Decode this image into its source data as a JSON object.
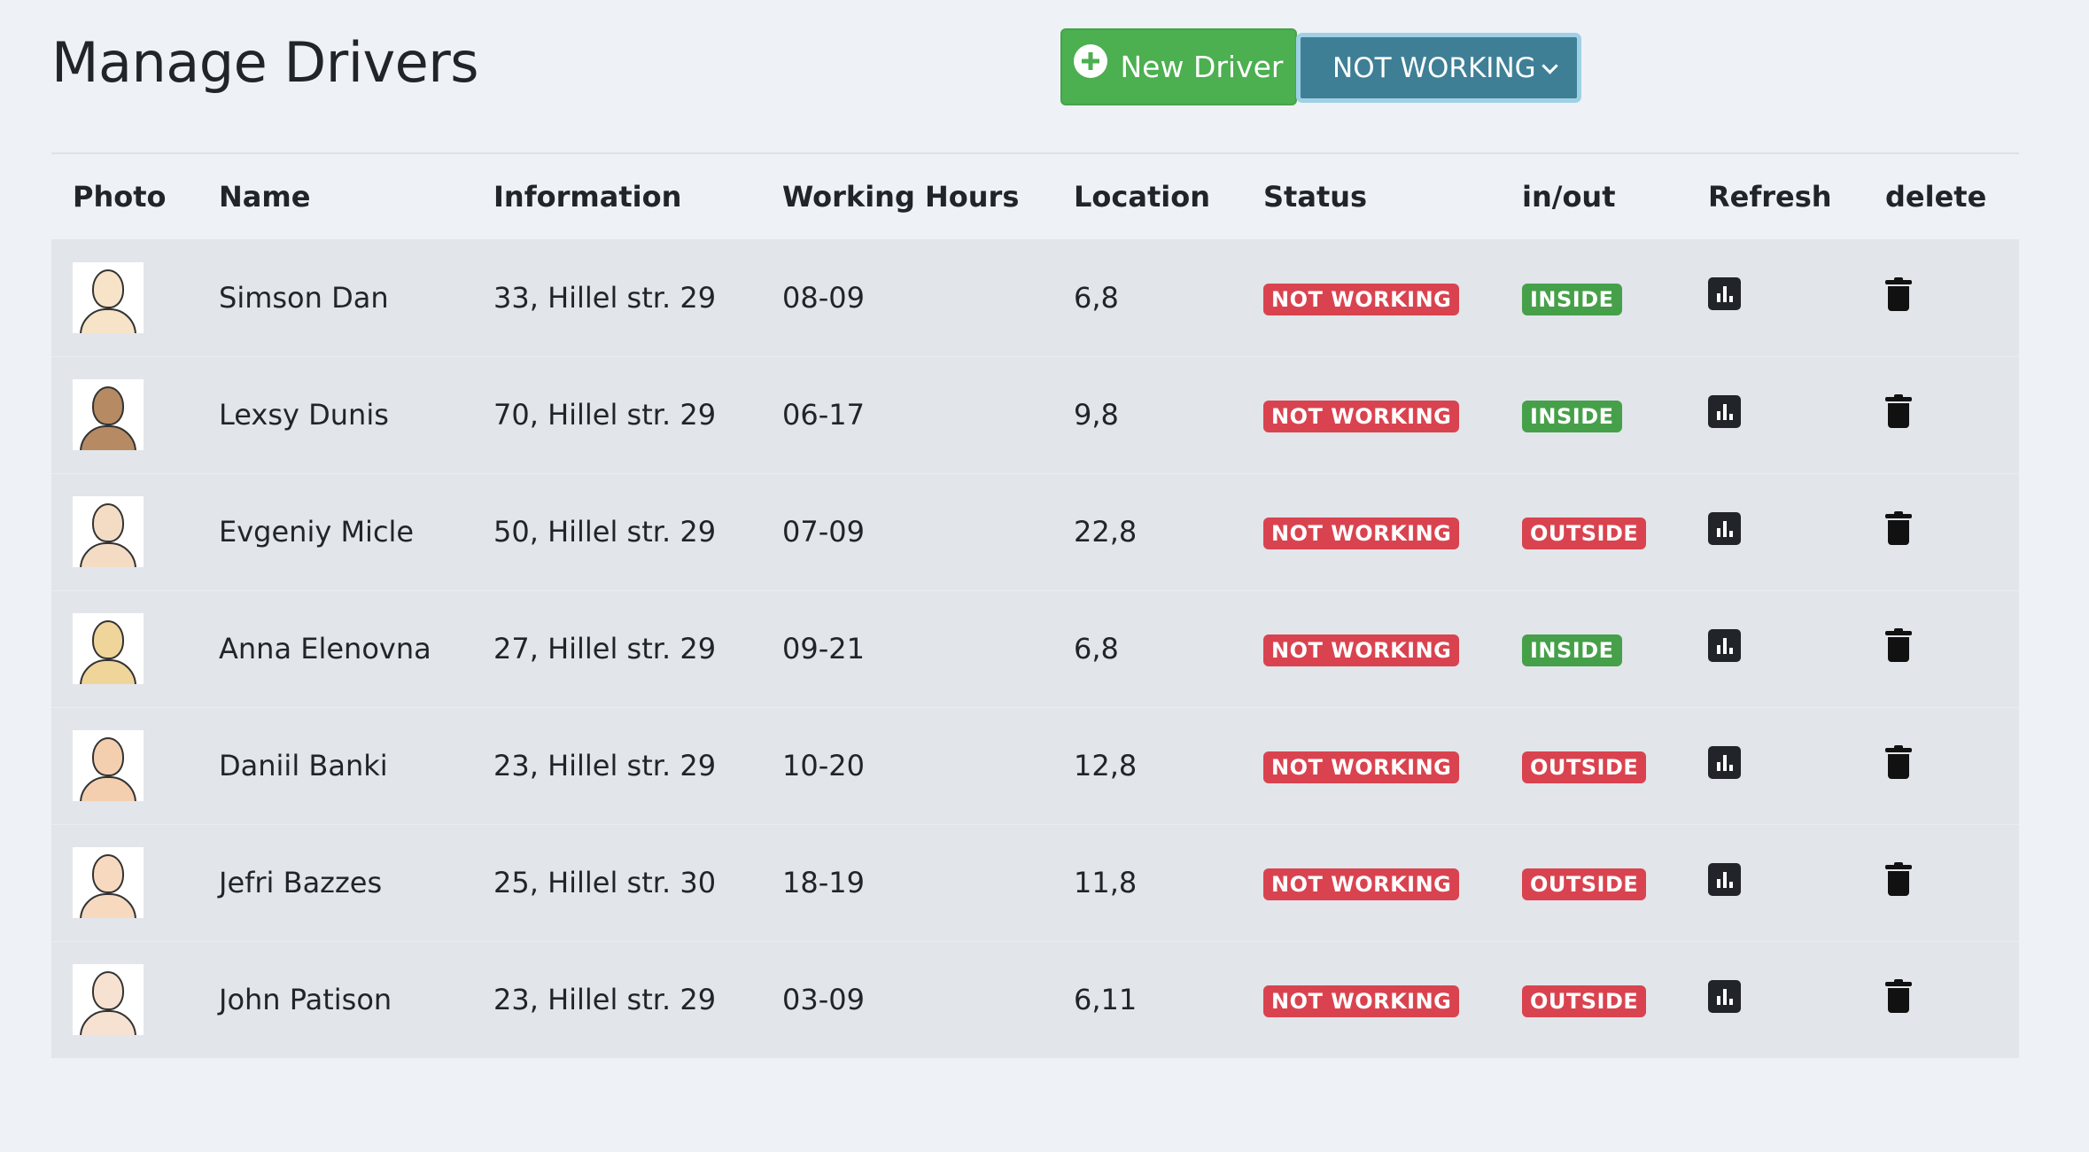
{
  "header": {
    "title": "Manage Drivers",
    "new_button_label": "New Driver",
    "filter_value": "NOT WORKING"
  },
  "table": {
    "columns": [
      "Photo",
      "Name",
      "Information",
      "Working Hours",
      "Location",
      "Status",
      "in/out",
      "Refresh",
      "delete"
    ],
    "rows": [
      {
        "name": "Simson Dan",
        "info": "33, Hillel str. 29",
        "hours": "08-09",
        "location": "6,8",
        "status": "NOT WORKING",
        "inout": "INSIDE",
        "photo_color": "#f6e3c8"
      },
      {
        "name": "Lexsy Dunis",
        "info": "70, Hillel str. 29",
        "hours": "06-17",
        "location": "9,8",
        "status": "NOT WORKING",
        "inout": "INSIDE",
        "photo_color": "#b68a63"
      },
      {
        "name": "Evgeniy Micle",
        "info": "50, Hillel str. 29",
        "hours": "07-09",
        "location": "22,8",
        "status": "NOT WORKING",
        "inout": "OUTSIDE",
        "photo_color": "#f4dcc4"
      },
      {
        "name": "Anna Elenovna",
        "info": "27, Hillel str. 29",
        "hours": "09-21",
        "location": "6,8",
        "status": "NOT WORKING",
        "inout": "INSIDE",
        "photo_color": "#f0d59a"
      },
      {
        "name": "Daniil Banki",
        "info": "23, Hillel str. 29",
        "hours": "10-20",
        "location": "12,8",
        "status": "NOT WORKING",
        "inout": "OUTSIDE",
        "photo_color": "#f3cfb0"
      },
      {
        "name": "Jefri Bazzes",
        "info": "25, Hillel str. 30",
        "hours": "18-19",
        "location": "11,8",
        "status": "NOT WORKING",
        "inout": "OUTSIDE",
        "photo_color": "#f6d9bf"
      },
      {
        "name": "John Patison",
        "info": "23, Hillel str. 29",
        "hours": "03-09",
        "location": "6,11",
        "status": "NOT WORKING",
        "inout": "OUTSIDE",
        "photo_color": "#f7e2d2"
      }
    ]
  },
  "colors": {
    "status_not_working": "#d9434f",
    "inside": "#46a049",
    "outside": "#d9434f",
    "new_button": "#4caf50",
    "filter_select": "#3e7f96"
  },
  "icons": {
    "refresh": "bar-chart-icon",
    "delete": "trash-icon",
    "new": "plus-circle-icon",
    "filter": "chevron-down-icon"
  }
}
